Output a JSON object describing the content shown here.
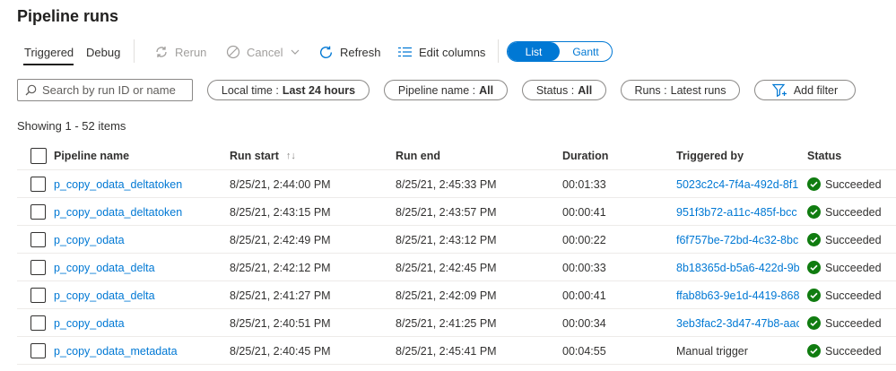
{
  "page": {
    "title": "Pipeline runs"
  },
  "toolbar": {
    "tabs": [
      {
        "label": "Triggered",
        "active": true
      },
      {
        "label": "Debug",
        "active": false
      }
    ],
    "rerun_label": "Rerun",
    "cancel_label": "Cancel",
    "refresh_label": "Refresh",
    "edit_columns_label": "Edit columns",
    "view_toggle": {
      "options": [
        "List",
        "Gantt"
      ],
      "selected": "List"
    }
  },
  "filters": {
    "search_placeholder": "Search by run ID or name",
    "local_time": {
      "label": "Local time :",
      "value": "Last 24 hours"
    },
    "pipeline_name": {
      "label": "Pipeline name :",
      "value": "All"
    },
    "status": {
      "label": "Status :",
      "value": "All"
    },
    "runs": {
      "label": "Runs :",
      "value": "Latest runs"
    },
    "add_filter_label": "Add filter"
  },
  "showing_text": "Showing 1 - 52 items",
  "table": {
    "columns": [
      "Pipeline name",
      "Run start",
      "Run end",
      "Duration",
      "Triggered by",
      "Status"
    ],
    "sort_glyph": "↑↓",
    "rows": [
      {
        "name": "p_copy_odata_deltatoken",
        "start": "8/25/21, 2:44:00 PM",
        "end": "8/25/21, 2:45:33 PM",
        "duration": "00:01:33",
        "triggered_by": "5023c2c4-7f4a-492d-8f1",
        "status": "Succeeded"
      },
      {
        "name": "p_copy_odata_deltatoken",
        "start": "8/25/21, 2:43:15 PM",
        "end": "8/25/21, 2:43:57 PM",
        "duration": "00:00:41",
        "triggered_by": "951f3b72-a11c-485f-bcc",
        "status": "Succeeded"
      },
      {
        "name": "p_copy_odata",
        "start": "8/25/21, 2:42:49 PM",
        "end": "8/25/21, 2:43:12 PM",
        "duration": "00:00:22",
        "triggered_by": "f6f757be-72bd-4c32-8bc",
        "status": "Succeeded"
      },
      {
        "name": "p_copy_odata_delta",
        "start": "8/25/21, 2:42:12 PM",
        "end": "8/25/21, 2:42:45 PM",
        "duration": "00:00:33",
        "triggered_by": "8b18365d-b5a6-422d-9b",
        "status": "Succeeded"
      },
      {
        "name": "p_copy_odata_delta",
        "start": "8/25/21, 2:41:27 PM",
        "end": "8/25/21, 2:42:09 PM",
        "duration": "00:00:41",
        "triggered_by": "ffab8b63-9e1d-4419-868",
        "status": "Succeeded"
      },
      {
        "name": "p_copy_odata",
        "start": "8/25/21, 2:40:51 PM",
        "end": "8/25/21, 2:41:25 PM",
        "duration": "00:00:34",
        "triggered_by": "3eb3fac2-3d47-47b8-aac",
        "status": "Succeeded"
      },
      {
        "name": "p_copy_odata_metadata",
        "start": "8/25/21, 2:40:45 PM",
        "end": "8/25/21, 2:45:41 PM",
        "duration": "00:04:55",
        "triggered_by": "Manual trigger",
        "status": "Succeeded",
        "triggered_is_link": false
      }
    ]
  },
  "colors": {
    "accent": "#0078d4",
    "success": "#107c10",
    "text": "#323130",
    "disabled": "#a19f9d"
  },
  "icons": [
    "rerun-icon",
    "cancel-icon",
    "chevron-down-icon",
    "refresh-icon",
    "edit-columns-icon",
    "search-icon",
    "add-filter-icon",
    "sort-icon",
    "success-check-icon"
  ]
}
